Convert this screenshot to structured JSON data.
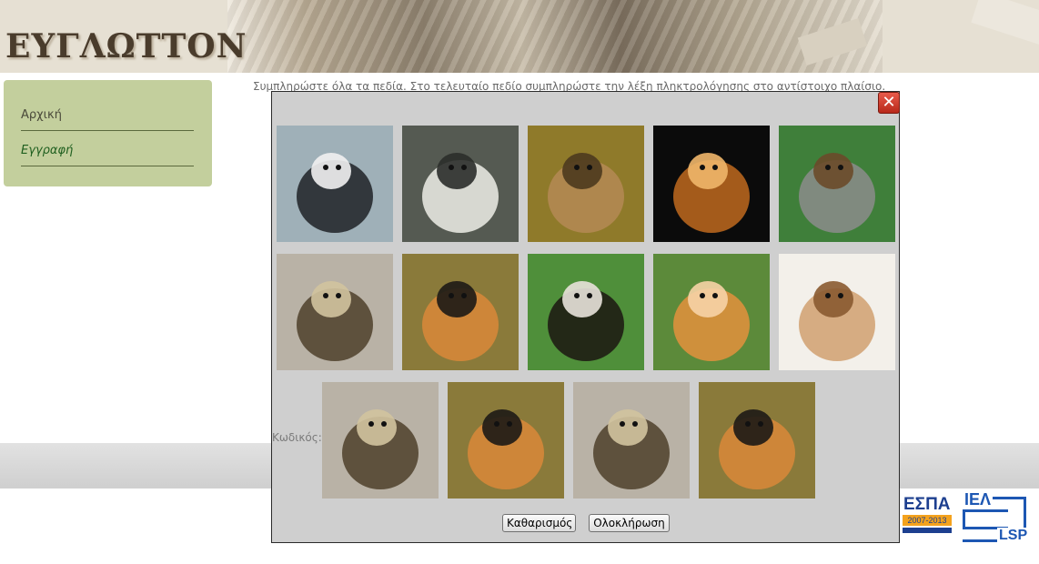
{
  "header": {
    "title": "ΕΥΓΛΩΤΤΟΝ"
  },
  "sidebar": {
    "items": [
      {
        "label": "Αρχική"
      },
      {
        "label": "Εγγραφή"
      }
    ]
  },
  "instructions": "Συμπληρώστε όλα τα πεδία. Στο τελευταίο πεδίο συμπληρώστε την λέξη πληκτρολόγησης στο αντίστοιχο πλαίσιο.",
  "modal": {
    "close_icon": "close-icon",
    "grid": [
      {
        "name": "penguins",
        "palette": [
          "#9fb0b8",
          "#1f2226",
          "#f1f1f1"
        ]
      },
      {
        "name": "polar-bear",
        "palette": [
          "#555a52",
          "#efeee8",
          "#2b2e2a"
        ]
      },
      {
        "name": "deer",
        "palette": [
          "#8f7a2a",
          "#b58a55",
          "#4d3a1e"
        ]
      },
      {
        "name": "lion",
        "palette": [
          "#0b0b0b",
          "#c06a1e",
          "#f0b66a"
        ]
      },
      {
        "name": "koala",
        "palette": [
          "#3f7f3a",
          "#8c8c8c",
          "#6a4a2a"
        ]
      },
      {
        "name": "ducklings",
        "palette": [
          "#b9b2a6",
          "#4e3f2a",
          "#d2c39e"
        ]
      },
      {
        "name": "tigers",
        "palette": [
          "#8a7a3a",
          "#d9883a",
          "#1d1a16"
        ]
      },
      {
        "name": "puppy-kitten",
        "palette": [
          "#4f8f3a",
          "#1b1612",
          "#e8e2da"
        ]
      },
      {
        "name": "kitten",
        "palette": [
          "#5c8a3a",
          "#e3913d",
          "#f6d3a6"
        ]
      },
      {
        "name": "rat-teddy",
        "palette": [
          "#f3f0ea",
          "#d0a070",
          "#8a5a30"
        ]
      }
    ],
    "code_label": "Κωδικός:",
    "code_images": [
      {
        "name": "ducklings",
        "palette": [
          "#b9b2a6",
          "#4e3f2a",
          "#d2c39e"
        ]
      },
      {
        "name": "tigers",
        "palette": [
          "#8a7a3a",
          "#d9883a",
          "#1d1a16"
        ]
      },
      {
        "name": "ducklings",
        "palette": [
          "#b9b2a6",
          "#4e3f2a",
          "#d2c39e"
        ]
      },
      {
        "name": "tigers",
        "palette": [
          "#8a7a3a",
          "#d9883a",
          "#1d1a16"
        ]
      }
    ],
    "clear_label": "Καθαρισμός",
    "finish_label": "Ολοκλήρωση"
  },
  "logos": {
    "espa": {
      "line1": "ΕΣΠΑ",
      "line2": "2007-2013"
    },
    "iel": {
      "line1": "ΙΕΛ",
      "line2": "LSP"
    }
  }
}
